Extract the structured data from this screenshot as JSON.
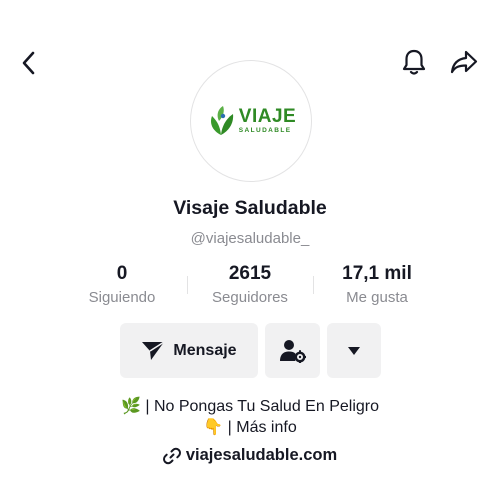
{
  "header": {
    "back_icon": "chevron-left-icon",
    "bell_icon": "bell-icon",
    "share_icon": "share-arrow-icon"
  },
  "profile": {
    "logo_main": "VIAJE",
    "logo_sub": "SALUDABLE",
    "display_name": "Visaje Saludable",
    "handle": "@viajesaludable_"
  },
  "stats": [
    {
      "value": "0",
      "label": "Siguiendo"
    },
    {
      "value": "2615",
      "label": "Seguidores"
    },
    {
      "value": "17,1 mil",
      "label": "Me gusta"
    }
  ],
  "actions": {
    "message_label": "Mensaje",
    "message_icon": "send-icon",
    "friends_icon": "user-settings-icon",
    "more_icon": "caret-down-icon"
  },
  "bio": {
    "line1_emoji": "🌿",
    "line1_text": "| No Pongas Tu Salud En Peligro",
    "line2_emoji": "👇",
    "line2_text": "| Más info"
  },
  "website": {
    "url": "viajesaludable.com",
    "icon": "link-icon"
  },
  "colors": {
    "brand_green": "#2f8a25",
    "button_bg": "#f1f1f2",
    "secondary_text": "#8a8b91"
  }
}
